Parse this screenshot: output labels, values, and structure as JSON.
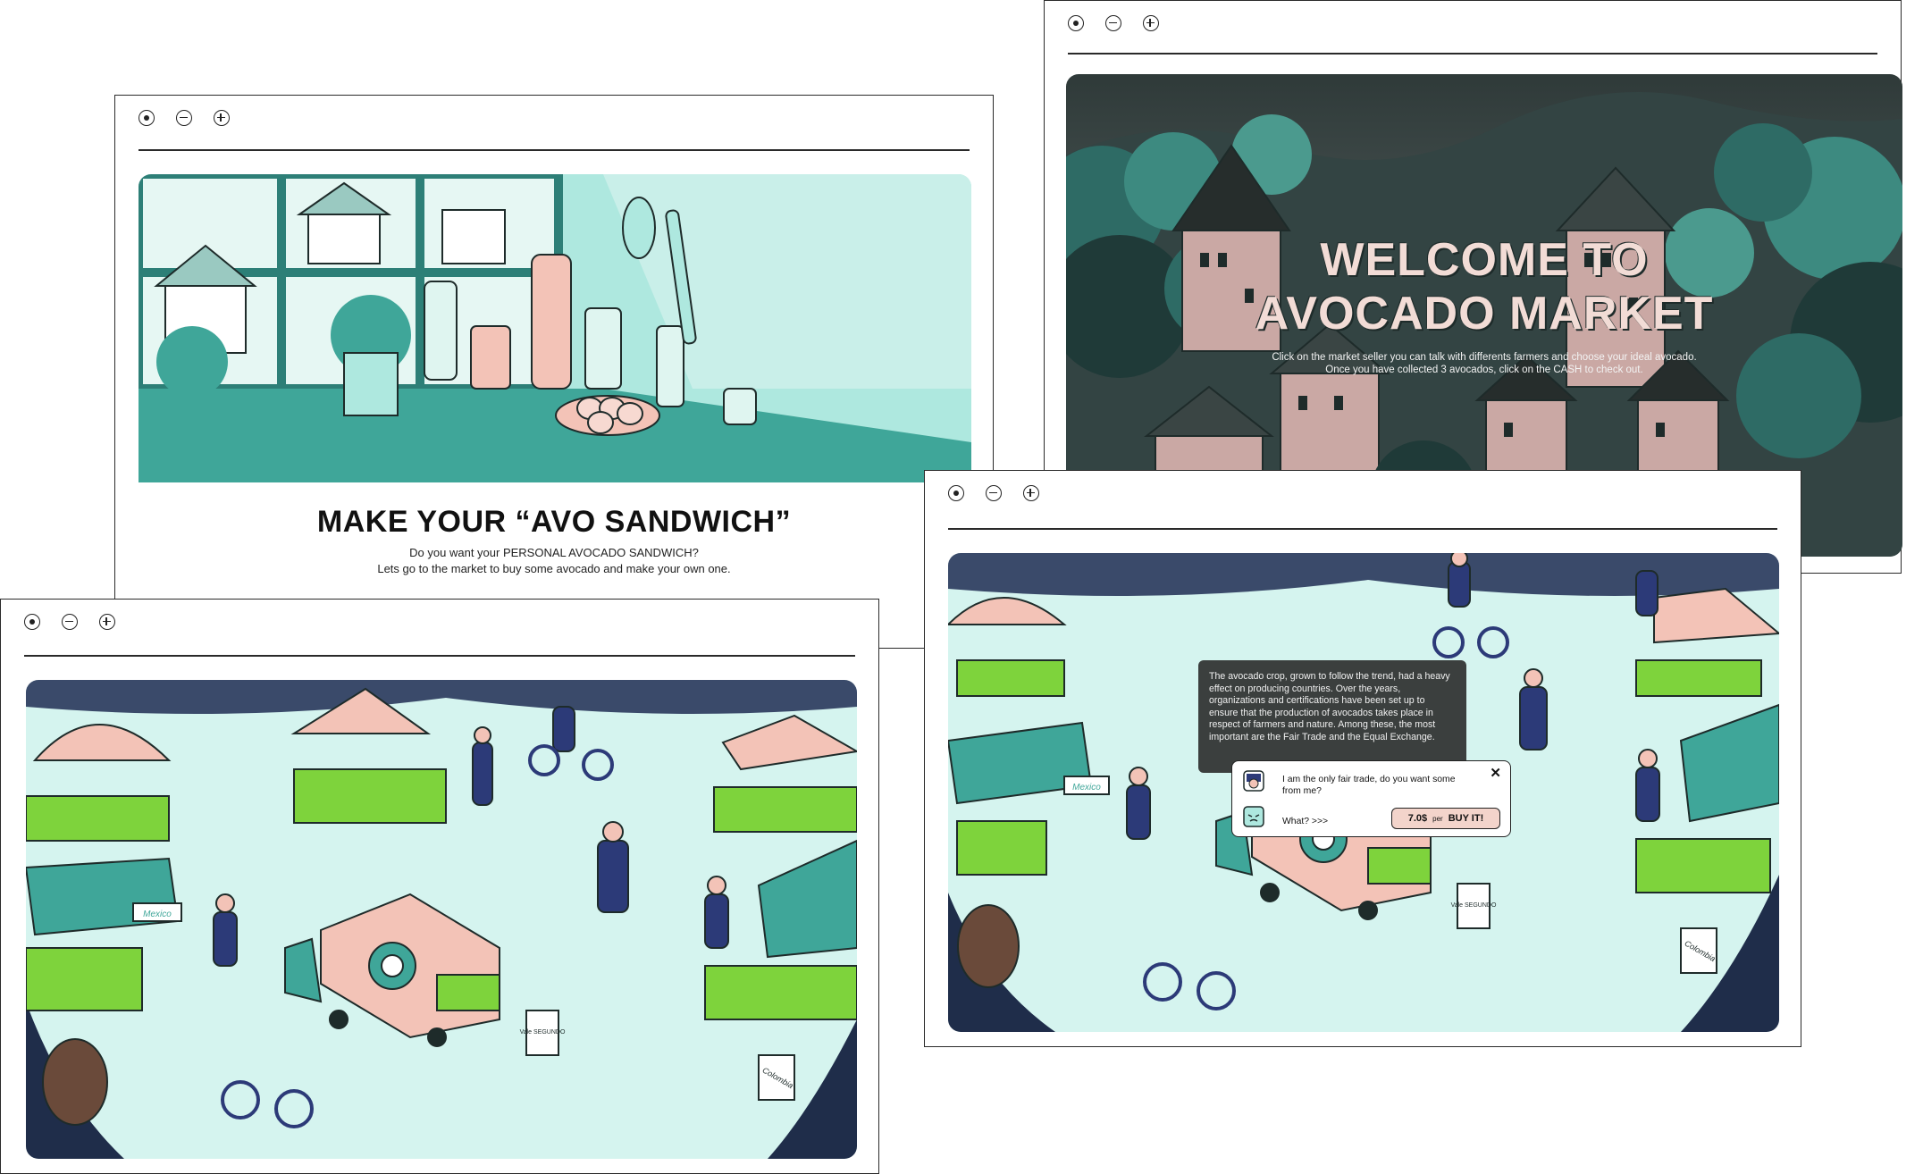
{
  "window_controls": {
    "target_icon": "target-icon",
    "minus_icon": "zoom-out-icon",
    "plus_icon": "zoom-in-icon"
  },
  "welcome_window": {
    "title": "WELCOME TO\nAVOCADO MARKET",
    "instructions_line1": "Click on the market seller you can talk with differents farmers and choose your ideal avocado.",
    "instructions_line2": "Once you have collected 3 avocados, click on the CASH to check out."
  },
  "sandwich_window": {
    "title": "MAKE YOUR “AVO SANDWICH”",
    "line1": "Do you want your PERSONAL AVOCADO SANDWICH?",
    "line2": "Lets go to the market to buy some avocado and make your own one."
  },
  "market_window_left": {
    "sign_mexico": "Mexico",
    "sign_colombia": "Colombia",
    "sign_vale": "Vale SEGUNDO"
  },
  "market_window_right": {
    "info_text": "The avocado crop, grown to follow the trend, had a heavy effect on producing countries. Over the years, organizations and certifications have been set up to ensure that the production of avocados takes place in respect of farmers and nature. Among these, the most important are the Fair Trade and the Equal Exchange.",
    "dialog": {
      "seller_message": "I am the only fair trade, do you want some from me?",
      "reply": "What?  >>>",
      "price": "7.0$",
      "per": "per",
      "buy_label": "BUY IT!",
      "close_glyph": "✕"
    },
    "sign_mexico": "Mexico",
    "sign_colombia": "Colombia",
    "sign_vale": "Vale SEGUNDO"
  },
  "colors": {
    "mint": "#aee8df",
    "teal": "#3fa699",
    "dark_teal": "#2d7f77",
    "pink": "#f3c3b7",
    "navy": "#2c3a78",
    "night_bg": "#3b4a49",
    "avocado_green": "#7ed33c"
  }
}
